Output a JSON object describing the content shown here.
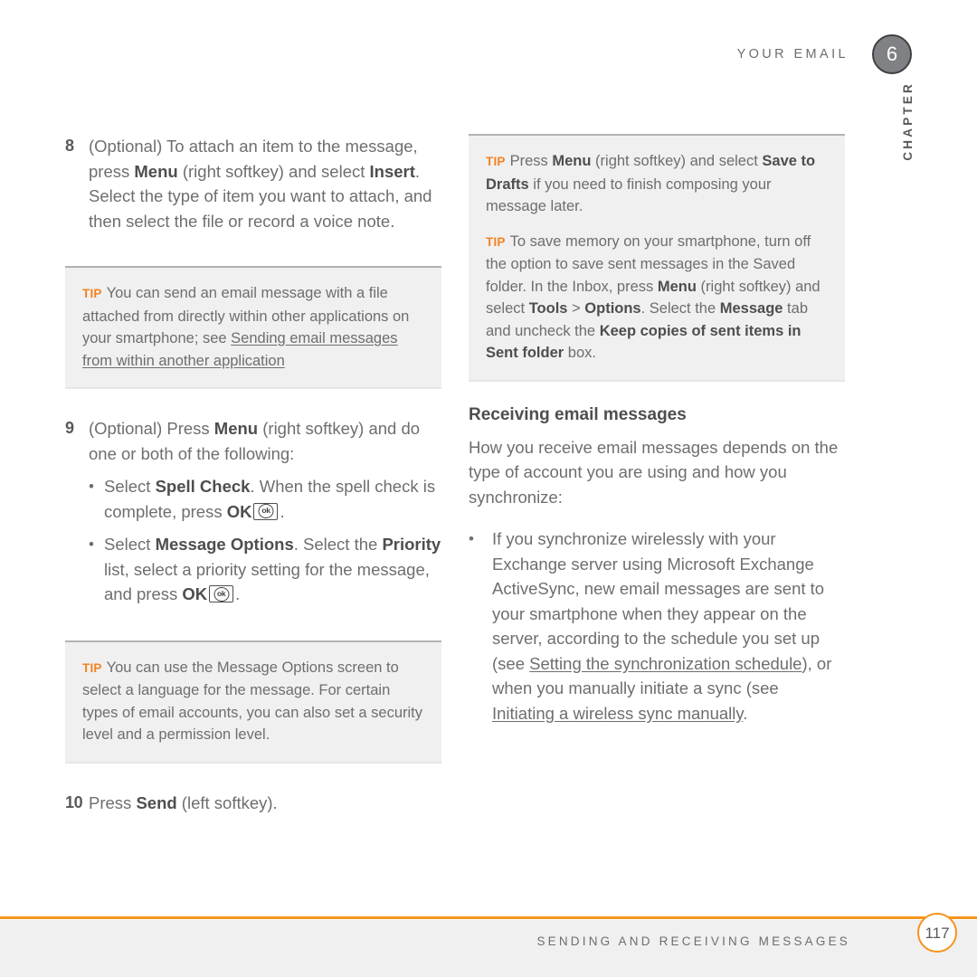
{
  "header": {
    "running_title": "YOUR EMAIL",
    "chapter_number": "6",
    "chapter_label": "CHAPTER"
  },
  "left_column": {
    "step8": {
      "number": "8",
      "t1": "(Optional) To attach an item to the message, press ",
      "b1": "Menu",
      "t2": " (right softkey) and select ",
      "b2": "Insert",
      "t3": ". Select the type of item you want to attach, and then select the file or record a voice note."
    },
    "tip1": {
      "label": "TIP",
      "t1": "You can send an email message with a file attached from directly within other applications on your smartphone; see ",
      "xref": "Sending email messages from within another application"
    },
    "step9": {
      "number": "9",
      "t1": "(Optional) Press ",
      "b1": "Menu",
      "t2": " (right softkey) and do one or both of the following:",
      "bullets": [
        {
          "t1": "Select ",
          "b1": "Spell Check",
          "t2": ". When the spell check is complete, press ",
          "b2": "OK",
          "icon": "ok-key-icon",
          "t3": "."
        },
        {
          "t1": "Select ",
          "b1": "Message Options",
          "t2": ". Select the ",
          "b2": "Priority",
          "t3": " list, select a priority setting for the message, and press ",
          "b3": "OK",
          "icon": "ok-key-icon",
          "t4": "."
        }
      ]
    },
    "tip2": {
      "label": "TIP",
      "t1": "You can use the Message Options screen to select a language for the message. For certain types of email accounts, you can also set a security level and a permission level."
    },
    "step10": {
      "number": "10",
      "t1": "Press ",
      "b1": "Send",
      "t2": " (left softkey)."
    }
  },
  "right_column": {
    "tip3": {
      "label": "TIP",
      "t1": "Press ",
      "b1": "Menu",
      "t2": " (right softkey) and select ",
      "b2": "Save to Drafts",
      "t3": " if you need to finish composing your message later."
    },
    "tip4": {
      "label": "TIP",
      "t1": "To save memory on your smartphone, turn off the option to save sent messages in the Saved folder. In the Inbox, press ",
      "b1": "Menu",
      "t2": " (right softkey) and select ",
      "b2": "Tools",
      "t3": " > ",
      "b3": "Options",
      "t4": ". Select the ",
      "b4": "Message",
      "t5": " tab and uncheck the ",
      "b5": "Keep copies of sent items in Sent folder",
      "t6": " box."
    },
    "heading": "Receiving email messages",
    "intro": "How you receive email messages depends on the type of account you are using and how you synchronize:",
    "bullet1": {
      "t1": "If you synchronize wirelessly with your Exchange server using Microsoft Exchange ActiveSync, new email messages are sent to your smartphone when they appear on the server, according to the schedule you set up (see ",
      "xref1": "Setting the synchronization schedule",
      "t2": "), or when you manually initiate a sync (see ",
      "xref2": "Initiating a wireless sync manually",
      "t3": "."
    }
  },
  "footer": {
    "title": "SENDING AND RECEIVING MESSAGES",
    "page_number": "117"
  }
}
